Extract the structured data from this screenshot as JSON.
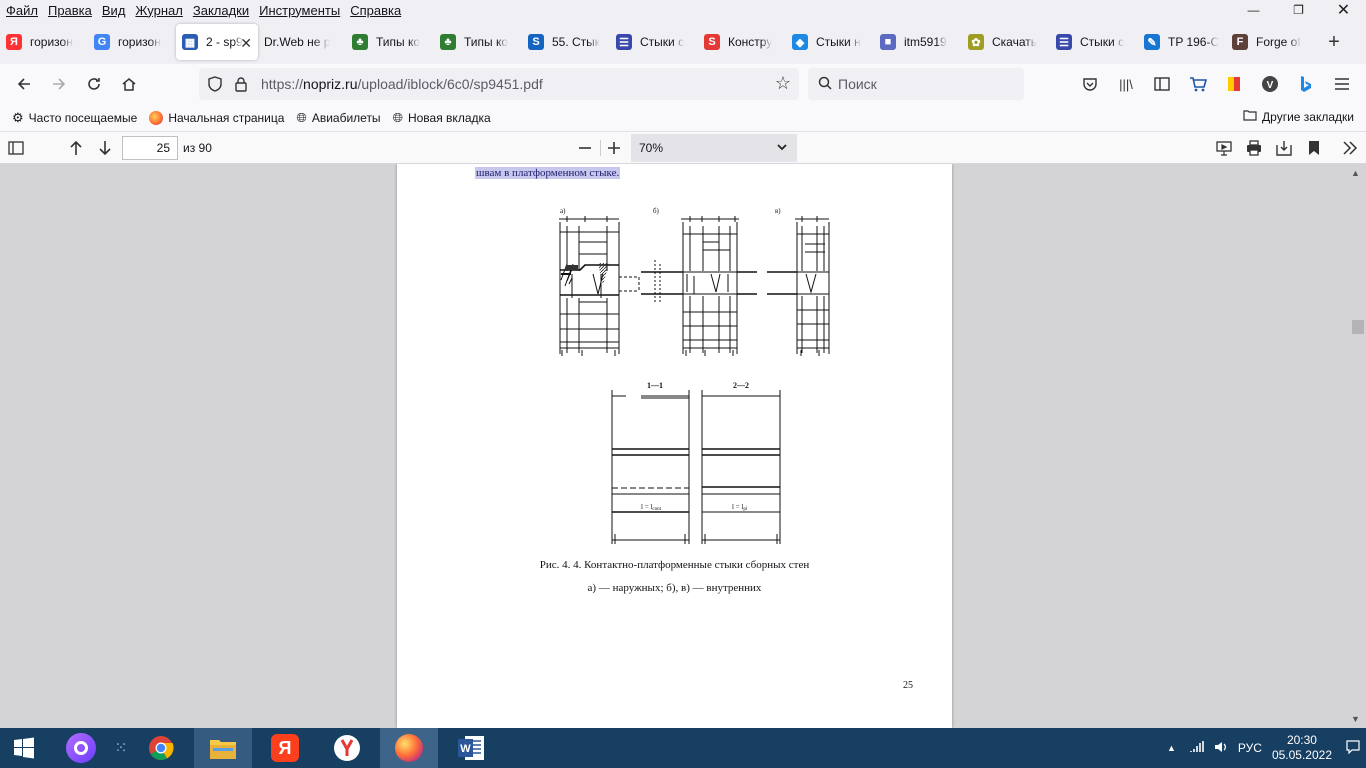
{
  "menu": [
    "Файл",
    "Правка",
    "Вид",
    "Журнал",
    "Закладки",
    "Инструменты",
    "Справка"
  ],
  "tabs": [
    {
      "label": "горизон",
      "icon": "yandex-icon",
      "color": "#ff3333",
      "glyph": "Я"
    },
    {
      "label": "горизон",
      "icon": "google-icon",
      "color": "#4285f4",
      "glyph": "G"
    },
    {
      "label": "2 - sp9",
      "icon": "nopriz-icon",
      "color": "#2a5db0",
      "glyph": "▦",
      "active": true
    },
    {
      "label": "Dr.Web не р",
      "icon": "",
      "color": "",
      "glyph": ""
    },
    {
      "label": "Типы ко",
      "icon": "tree-icon",
      "color": "#2e7d32",
      "glyph": "♣"
    },
    {
      "label": "Типы ко",
      "icon": "tree-icon",
      "color": "#2e7d32",
      "glyph": "♣"
    },
    {
      "label": "55. Стык",
      "icon": "s-icon",
      "color": "#1565c0",
      "glyph": "S"
    },
    {
      "label": "Стыки с",
      "icon": "doc-icon",
      "color": "#3949ab",
      "glyph": "☰"
    },
    {
      "label": "Констру",
      "icon": "s-red-icon",
      "color": "#e53935",
      "glyph": "S"
    },
    {
      "label": "Стыки н",
      "icon": "cube-icon",
      "color": "#1e88e5",
      "glyph": "◆"
    },
    {
      "label": "itm5919",
      "icon": "box-icon",
      "color": "#5c6bc0",
      "glyph": "■"
    },
    {
      "label": "Скачать",
      "icon": "flower-icon",
      "color": "#9e9d24",
      "glyph": "✿"
    },
    {
      "label": "Стыки с",
      "icon": "doc-icon",
      "color": "#3949ab",
      "glyph": "☰"
    },
    {
      "label": "TP 196-С",
      "icon": "pen-icon",
      "color": "#1976d2",
      "glyph": "✎"
    },
    {
      "label": "Forge of",
      "icon": "forge-icon",
      "color": "#5d4037",
      "glyph": "F"
    }
  ],
  "url": {
    "prefix": "https://",
    "host": "nopriz.ru",
    "path": "/upload/iblock/6c0/sp9451.pdf"
  },
  "search_placeholder": "Поиск",
  "bookmarks": [
    "Часто посещаемые",
    "Начальная страница",
    "Авиабилеты",
    "Новая вкладка"
  ],
  "other_bookmarks": "Другие закладки",
  "pdf": {
    "page": "25",
    "page_count": "из 90",
    "zoom": "70%"
  },
  "doc": {
    "highlight": "швам в платформенном стыке.",
    "caption1": "Рис. 4. 4.  Контактно-платформенные стыки сборных стен",
    "caption2": "а) — наружных; б), в) — внутренних",
    "page_number": "25",
    "fig_labels": {
      "a": "а)",
      "b": "б)",
      "c": "в)",
      "s11": "1—1",
      "s22": "2—2",
      "l1": "l = l",
      "l2": "l = l"
    },
    "fig_subs": {
      "l1": "cont",
      "l2": "pl"
    }
  },
  "taskbar": {
    "lang": "РУС",
    "time": "20:30",
    "date": "05.05.2022"
  }
}
